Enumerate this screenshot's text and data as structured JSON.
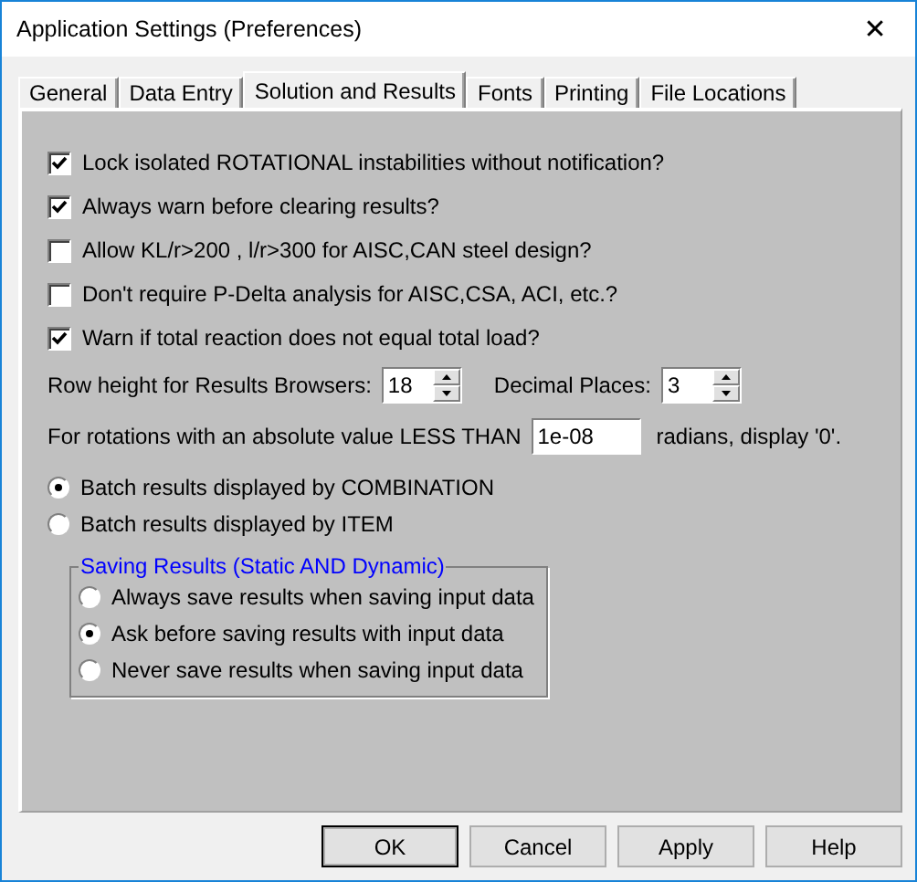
{
  "window": {
    "title": "Application Settings (Preferences)",
    "close": "✕"
  },
  "tabs": [
    {
      "label": "General",
      "selected": false
    },
    {
      "label": "Data Entry",
      "selected": false
    },
    {
      "label": "Solution and Results",
      "selected": true
    },
    {
      "label": "Fonts",
      "selected": false
    },
    {
      "label": "Printing",
      "selected": false
    },
    {
      "label": "File Locations",
      "selected": false
    }
  ],
  "checkboxes": [
    {
      "label": "Lock isolated ROTATIONAL instabilities without notification?",
      "checked": true
    },
    {
      "label": "Always warn before clearing results?",
      "checked": true
    },
    {
      "label": "Allow KL/r>200 , l/r>300 for AISC,CAN steel design?",
      "checked": false
    },
    {
      "label": "Don't require P-Delta analysis for AISC,CSA, ACI, etc.?",
      "checked": false
    },
    {
      "label": "Warn if total reaction does not equal total load?",
      "checked": true
    }
  ],
  "row_height": {
    "label": "Row height for Results Browsers:",
    "value": "18"
  },
  "decimal_places": {
    "label": "Decimal Places:",
    "value": "3"
  },
  "rotation": {
    "label": "For rotations with an absolute value LESS THAN",
    "value": "1e-08",
    "suffix": "radians, display '0'."
  },
  "batch_display": [
    {
      "label": "Batch results displayed by COMBINATION",
      "selected": true
    },
    {
      "label": "Batch results displayed by ITEM",
      "selected": false
    }
  ],
  "saving_results": {
    "title": "Saving Results (Static AND Dynamic)",
    "options": [
      {
        "label": "Always save results when saving input data",
        "selected": false
      },
      {
        "label": "Ask before saving results with input data",
        "selected": true
      },
      {
        "label": "Never save results when saving input data",
        "selected": false
      }
    ]
  },
  "buttons": [
    {
      "label": "OK",
      "default": true
    },
    {
      "label": "Cancel",
      "default": false
    },
    {
      "label": "Apply",
      "default": false
    },
    {
      "label": "Help",
      "default": false
    }
  ]
}
